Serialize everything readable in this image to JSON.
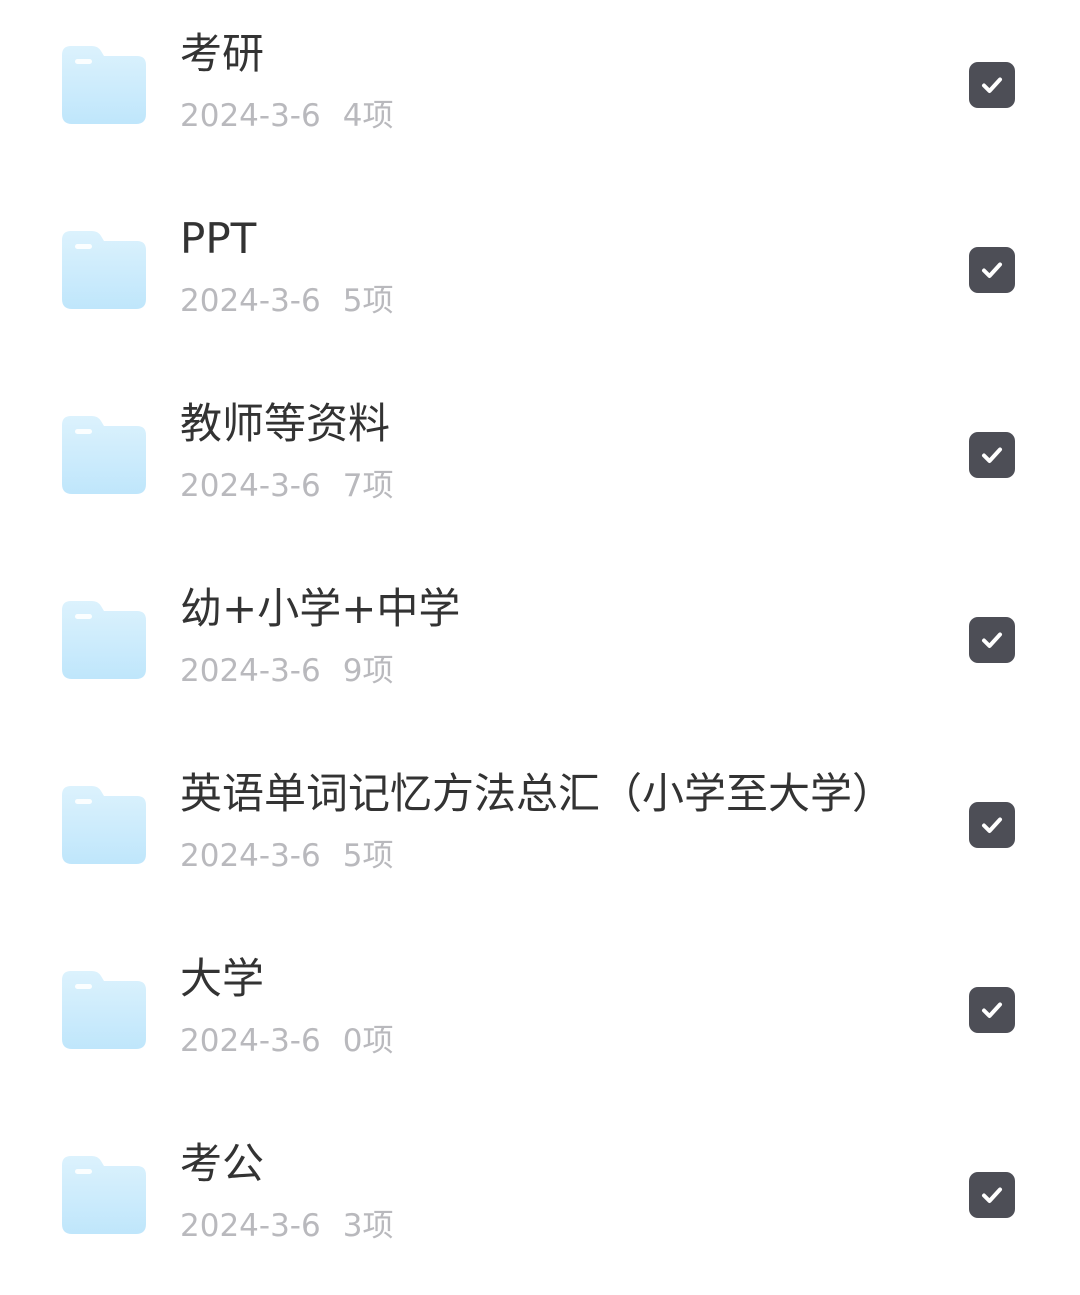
{
  "colors": {
    "folder_light": "#dcf2fd",
    "folder_dark": "#bfe6fb",
    "checkbox": "#4d4e56",
    "title_text": "#333333",
    "meta_text": "#b9b9bd"
  },
  "icons": {
    "folder": "folder-icon",
    "checkbox": "checkmark-icon"
  },
  "folders": [
    {
      "name": "考研",
      "date": "2024-3-6",
      "count": "4项",
      "checked": true
    },
    {
      "name": "PPT",
      "date": "2024-3-6",
      "count": "5项",
      "checked": true
    },
    {
      "name": "教师等资料",
      "date": "2024-3-6",
      "count": "7项",
      "checked": true
    },
    {
      "name": "幼+小学+中学",
      "date": "2024-3-6",
      "count": "9项",
      "checked": true
    },
    {
      "name": "英语单词记忆方法总汇（小学至大学）",
      "date": "2024-3-6",
      "count": "5项",
      "checked": true
    },
    {
      "name": "大学",
      "date": "2024-3-6",
      "count": "0项",
      "checked": true
    },
    {
      "name": "考公",
      "date": "2024-3-6",
      "count": "3项",
      "checked": true
    }
  ]
}
